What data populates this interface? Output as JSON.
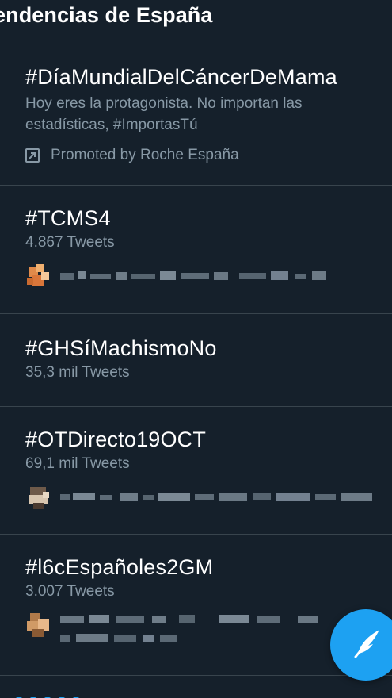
{
  "header": {
    "title": "endencias de España"
  },
  "trends": [
    {
      "name": "#DíaMundialDelCáncerDeMama",
      "description": "Hoy eres la protagonista. No importan las estadísticas, #ImportasTú",
      "promoted": "Promoted by Roche España"
    },
    {
      "name": "#TCMS4",
      "count": "4.867 Tweets"
    },
    {
      "name": "#GHSíMachismoNo",
      "count": "35,3 mil Tweets"
    },
    {
      "name": "#OTDirecto19OCT",
      "count": "69,1 mil Tweets"
    },
    {
      "name": "#l6cEspañoles2GM",
      "count": "3.007 Tweets"
    }
  ],
  "fab": {
    "icon": "compose-tweet-icon"
  },
  "colors": {
    "background": "#15202b",
    "divider": "#38444d",
    "secondary_text": "#8899a6",
    "accent": "#1da1f2"
  }
}
